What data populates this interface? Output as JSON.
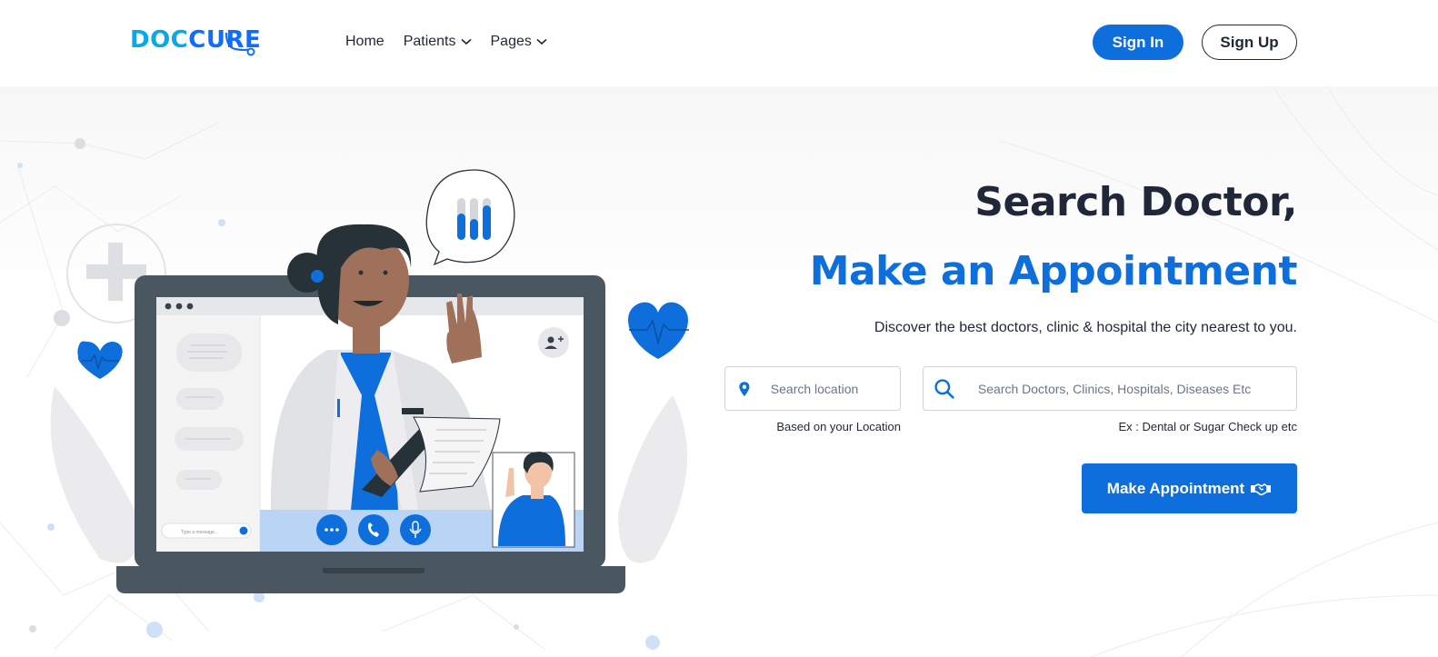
{
  "header": {
    "logo": {
      "part1": "DOC",
      "part2": "CURE"
    },
    "nav": [
      {
        "label": "Home",
        "has_dropdown": false
      },
      {
        "label": "Patients",
        "has_dropdown": true
      },
      {
        "label": "Pages",
        "has_dropdown": true
      }
    ],
    "signin_label": "Sign In",
    "signup_label": "Sign Up"
  },
  "hero": {
    "title_line1": "Search Doctor,",
    "title_line2": "Make an Appointment",
    "subtitle": "Discover the best doctors, clinic & hospital the city nearest to you.",
    "location_search": {
      "placeholder": "Search location",
      "value": "",
      "hint": "Based on your Location",
      "icon": "map-pin-icon"
    },
    "doctor_search": {
      "placeholder": "Search Doctors, Clinics, Hospitals, Diseases Etc",
      "value": "",
      "hint": "Ex : Dental or Sugar Check up etc",
      "icon": "search-icon"
    },
    "appointment_button": {
      "label": "Make Appointment",
      "icon": "handshake-icon"
    },
    "illustration": {
      "chat_input_placeholder": "Type a message...",
      "icons": [
        "more-icon",
        "phone-icon",
        "microphone-icon",
        "add-user-icon",
        "heart-pulse-icon",
        "plus-icon",
        "bar-chart-bubble-icon"
      ]
    }
  },
  "colors": {
    "primary": "#0e6fdc",
    "dark_text": "#1f2739",
    "logo_light": "#09a9e8",
    "laptop_frame": "#4a5660"
  }
}
